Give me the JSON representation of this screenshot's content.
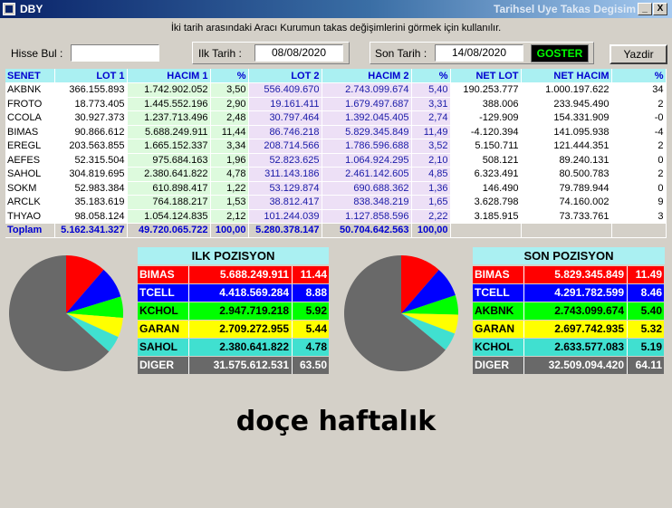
{
  "window": {
    "title": "DBY",
    "title_right": "Tarihsel Uye Takas Degisim",
    "minimize_label": "_",
    "close_label": "X"
  },
  "info_text": "İki tarih arasındaki  Aracı Kurumun takas değişimlerini görmek için kullanılır.",
  "controls": {
    "hisse_label": "Hisse Bul :",
    "hisse_value": "",
    "ilk_label": "Ilk Tarih :",
    "ilk_value": "08/08/2020",
    "son_label": "Son Tarih :",
    "son_value": "14/08/2020",
    "goster_label": "GOSTER",
    "yazdir_label": "Yazdir"
  },
  "table": {
    "headers": [
      "SENET",
      "LOT 1",
      "HACIM 1",
      "%",
      "LOT 2",
      "HACIM 2",
      "%",
      "NET LOT",
      "NET HACIM",
      "%"
    ],
    "rows": [
      [
        "AKBNK",
        "366.155.893",
        "1.742.902.052",
        "3,50",
        "556.409.670",
        "2.743.099.674",
        "5,40",
        "190.253.777",
        "1.000.197.622",
        "34"
      ],
      [
        "FROTO",
        "18.773.405",
        "1.445.552.196",
        "2,90",
        "19.161.411",
        "1.679.497.687",
        "3,31",
        "388.006",
        "233.945.490",
        "2"
      ],
      [
        "CCOLA",
        "30.927.373",
        "1.237.713.496",
        "2,48",
        "30.797.464",
        "1.392.045.405",
        "2,74",
        "-129.909",
        "154.331.909",
        "-0"
      ],
      [
        "BIMAS",
        "90.866.612",
        "5.688.249.911",
        "11,44",
        "86.746.218",
        "5.829.345.849",
        "11,49",
        "-4.120.394",
        "141.095.938",
        "-4"
      ],
      [
        "EREGL",
        "203.563.855",
        "1.665.152.337",
        "3,34",
        "208.714.566",
        "1.786.596.688",
        "3,52",
        "5.150.711",
        "121.444.351",
        "2"
      ],
      [
        "AEFES",
        "52.315.504",
        "975.684.163",
        "1,96",
        "52.823.625",
        "1.064.924.295",
        "2,10",
        "508.121",
        "89.240.131",
        "0"
      ],
      [
        "SAHOL",
        "304.819.695",
        "2.380.641.822",
        "4,78",
        "311.143.186",
        "2.461.142.605",
        "4,85",
        "6.323.491",
        "80.500.783",
        "2"
      ],
      [
        "SOKM",
        "52.983.384",
        "610.898.417",
        "1,22",
        "53.129.874",
        "690.688.362",
        "1,36",
        "146.490",
        "79.789.944",
        "0"
      ],
      [
        "ARCLK",
        "35.183.619",
        "764.188.217",
        "1,53",
        "38.812.417",
        "838.348.219",
        "1,65",
        "3.628.798",
        "74.160.002",
        "9"
      ],
      [
        "THYAO",
        "98.058.124",
        "1.054.124.835",
        "2,12",
        "101.244.039",
        "1.127.858.596",
        "2,22",
        "3.185.915",
        "73.733.761",
        "3"
      ]
    ],
    "total": [
      "Toplam",
      "5.162.341.327",
      "49.720.065.722",
      "100,00",
      "5.280.378.147",
      "50.704.642.563",
      "100,00",
      "",
      "",
      ""
    ]
  },
  "ilk_pozisyon": {
    "title": "ILK POZISYON",
    "rows": [
      {
        "name": "BIMAS",
        "value": "5.688.249.911",
        "pct": "11.44",
        "pct_num": 11.44,
        "color": "#ff0000",
        "text_color": "#ffffff"
      },
      {
        "name": "TCELL",
        "value": "4.418.569.284",
        "pct": "8.88",
        "pct_num": 8.88,
        "color": "#0000ff",
        "text_color": "#ffffff"
      },
      {
        "name": "KCHOL",
        "value": "2.947.719.218",
        "pct": "5.92",
        "pct_num": 5.92,
        "color": "#00ff00",
        "text_color": "#000000"
      },
      {
        "name": "GARAN",
        "value": "2.709.272.955",
        "pct": "5.44",
        "pct_num": 5.44,
        "color": "#ffff00",
        "text_color": "#000000"
      },
      {
        "name": "SAHOL",
        "value": "2.380.641.822",
        "pct": "4.78",
        "pct_num": 4.78,
        "color": "#40e0d0",
        "text_color": "#000000"
      },
      {
        "name": "DIGER",
        "value": "31.575.612.531",
        "pct": "63.50",
        "pct_num": 63.5,
        "color": "#696969",
        "text_color": "#ffffff"
      }
    ]
  },
  "son_pozisyon": {
    "title": "SON POZISYON",
    "rows": [
      {
        "name": "BIMAS",
        "value": "5.829.345.849",
        "pct": "11.49",
        "pct_num": 11.49,
        "color": "#ff0000",
        "text_color": "#ffffff"
      },
      {
        "name": "TCELL",
        "value": "4.291.782.599",
        "pct": "8.46",
        "pct_num": 8.46,
        "color": "#0000ff",
        "text_color": "#ffffff"
      },
      {
        "name": "AKBNK",
        "value": "2.743.099.674",
        "pct": "5.40",
        "pct_num": 5.4,
        "color": "#00ff00",
        "text_color": "#000000"
      },
      {
        "name": "GARAN",
        "value": "2.697.742.935",
        "pct": "5.32",
        "pct_num": 5.32,
        "color": "#ffff00",
        "text_color": "#000000"
      },
      {
        "name": "KCHOL",
        "value": "2.633.577.083",
        "pct": "5.19",
        "pct_num": 5.19,
        "color": "#40e0d0",
        "text_color": "#000000"
      },
      {
        "name": "DIGER",
        "value": "32.509.094.420",
        "pct": "64.11",
        "pct_num": 64.11,
        "color": "#696969",
        "text_color": "#ffffff"
      }
    ]
  },
  "caption": "doçe haftalık"
}
